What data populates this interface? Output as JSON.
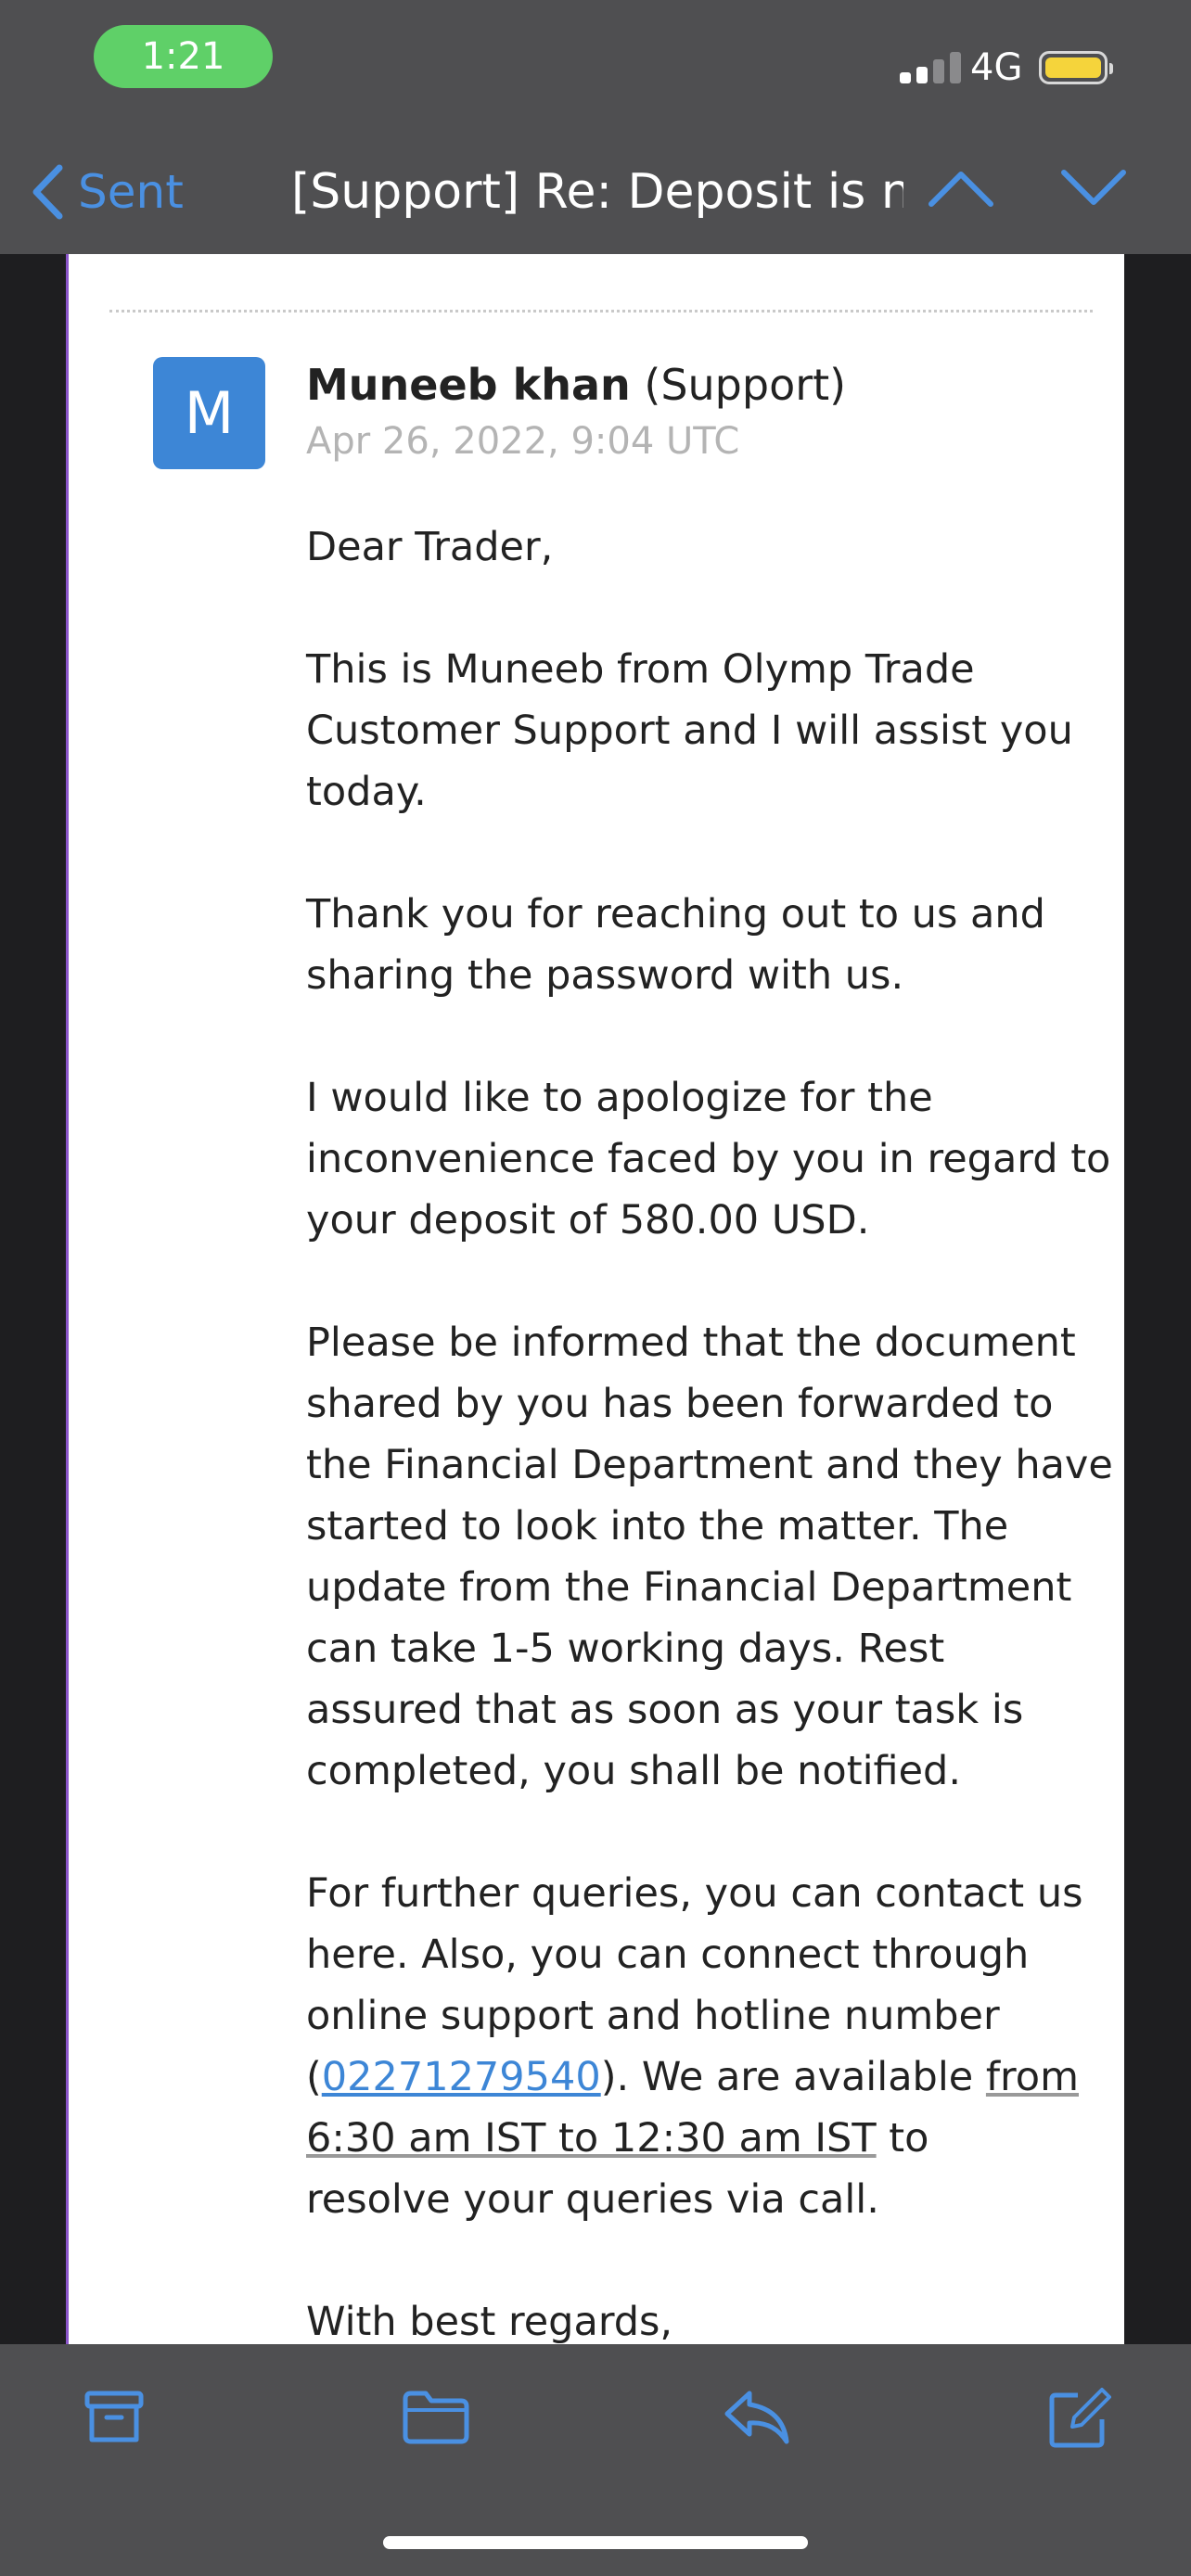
{
  "status_bar": {
    "time": "1:21",
    "network": "4G",
    "battery_color": "#f5d43b"
  },
  "nav": {
    "back_label": "Sent",
    "title": "[Support] Re: Deposit is n...",
    "accent_color": "#4a90e2"
  },
  "message": {
    "avatar_letter": "M",
    "sender_name": "Muneeb khan",
    "sender_role": "(Support)",
    "date": "Apr 26, 2022, 9:04 UTC",
    "greeting": "Dear Trader,",
    "p1": [
      "This is Muneeb from Olymp Trade",
      "Customer Support and I will assist you",
      "today."
    ],
    "p2": [
      "Thank you for reaching out to us and",
      "sharing the password with us."
    ],
    "p3": [
      "I would like to apologize for the",
      "inconvenience faced by you in regard to",
      "your deposit of 580.00 USD."
    ],
    "p4": [
      "Please be informed that the document",
      "shared by you has been forwarded to",
      "the Financial Department and they have",
      "started to look into the matter. The",
      "update from the Financial Department",
      "can take 1-5 working days. Rest",
      "assured that as soon as your task is",
      "completed, you shall be notified."
    ],
    "p5": {
      "line1": "For further queries, you can contact us",
      "line2": "here. Also, you can connect through",
      "line3": "online support and hotline number",
      "line4_open": "(",
      "phone": "02271279540",
      "line4_mid": "). We are available ",
      "line4_link": "from",
      "line5_link": "6:30 am IST to 12:30 am IST",
      "line5_rest": " to",
      "line6": "resolve your queries via call."
    },
    "closing": "With best regards,"
  },
  "toolbar": {
    "icons": [
      "archive-icon",
      "folder-icon",
      "reply-icon",
      "compose-icon"
    ]
  }
}
